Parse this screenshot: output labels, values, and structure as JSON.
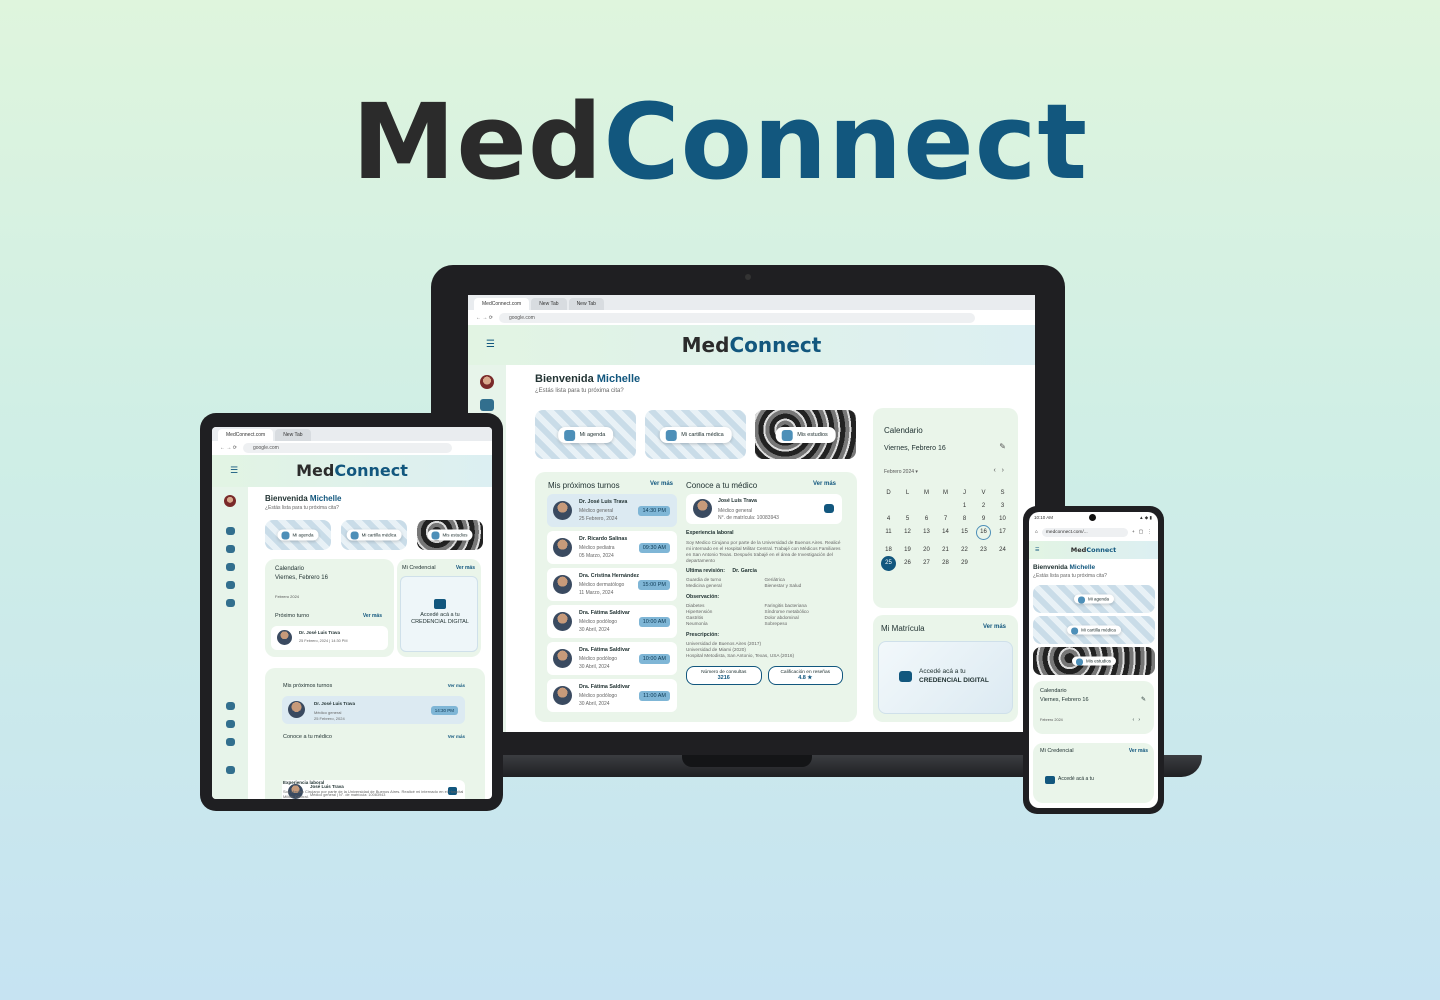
{
  "brand": {
    "part1": "Med",
    "part2": "Connect"
  },
  "browser": {
    "tabs": [
      "MedConnect.com",
      "New Tab",
      "New Tab"
    ],
    "url": "google.com",
    "phone_url": "medconnect.com/..."
  },
  "welcome": {
    "greeting": "Bienvenida",
    "name": "Michelle",
    "subtitle": "¿Estás lista para tu próxima cita?"
  },
  "tiles": [
    "Mi agenda",
    "Mi cartilla médica",
    "Mis estudios"
  ],
  "turnos": {
    "title": "Mis próximos turnos",
    "ver_mas": "Ver más",
    "items": [
      {
        "name": "Dr. José Luis Trava",
        "role": "Médico general",
        "date": "25 Febrero, 2024",
        "time": "14:30 PM"
      },
      {
        "name": "Dr. Ricardo Salinas",
        "role": "Médico pediatra",
        "date": "05 Marzo, 2024",
        "time": "09:30 AM"
      },
      {
        "name": "Dra. Cristina Hernández",
        "role": "Médico dermatólogo",
        "date": "11 Marzo, 2024",
        "time": "15:00 PM"
      },
      {
        "name": "Dra. Fátima Saldivar",
        "role": "Médico podólogo",
        "date": "30 Abril, 2024",
        "time": "10:00 AM"
      },
      {
        "name": "Dra. Fátima Saldivar",
        "role": "Médico podólogo",
        "date": "30 Abril, 2024",
        "time": "10:00 AM"
      },
      {
        "name": "Dra. Fátima Saldivar",
        "role": "Médico podólogo",
        "date": "30 Abril, 2024",
        "time": "11:00 AM"
      }
    ]
  },
  "medico": {
    "title": "Conoce a tu médico",
    "ver_mas": "Ver más",
    "name": "José Luis Trava",
    "role": "Médico general",
    "matricula": "N°. de matrícula: 10083943",
    "exp_label": "Experiencia laboral",
    "exp_text": "Soy Medico Cirujano por parte de la Universidad de Buenos Aires. Realicé mi internado en el Hospital Militar Central. Trabajé con Médicos Familiares en San Antonio Texas. Después trabajé en el área de Investigación del departamento",
    "revision_label": "Ultima revisión:",
    "revision_value": "Dr. García",
    "revision_items": [
      "Guardia de turno",
      "Medicina general",
      "Geriátrica",
      "Bienestar y Salud"
    ],
    "obs_label": "Observación:",
    "obs_items": [
      "Diabetes",
      "Hipertensión",
      "Gastritis",
      "Neumonía",
      "Faringitis bacteriana",
      "Síndrome metabólico",
      "Dolor abdominal",
      "Sobrepeso"
    ],
    "presc_label": "Prescripción:",
    "presc_items": [
      "Universidad de Buenos Aires (2017)",
      "Universidad de Miami (2020)",
      "Hospital Metodista, San Antonio, Texas, USA (2016)"
    ],
    "consultas_label": "Número de consultas",
    "consultas_value": "3216",
    "calif_label": "Calificación en reseñas",
    "calif_value": "4.8 ★"
  },
  "calendario": {
    "title": "Calendario",
    "date": "Viernes, Febrero 16",
    "month": "Febrero 2024",
    "weekdays": [
      "D",
      "L",
      "M",
      "M",
      "J",
      "V",
      "S"
    ],
    "selected": "25",
    "today": "16"
  },
  "matricula": {
    "title": "Mi Matrícula",
    "ver_mas": "Ver más",
    "cta": "Accedé acá a tu",
    "cta_bold": "CREDENCIAL DIGITAL"
  },
  "tablet": {
    "credencial_title": "Mi Credencial",
    "proximo_turno": "Próximo turno",
    "appt_date": "25 Febrero, 2024 | 14:30 PM",
    "medico_line": "Médico general | N°. de matrícula: 10083943",
    "exp_text": "Soy Medico Cirujano por parte de la Universidad de Buenos Aires. Realicé mi internado en el Hospital Militar Central."
  },
  "phone": {
    "time": "10:10 AM",
    "credencial_title": "Mi Credencial"
  }
}
